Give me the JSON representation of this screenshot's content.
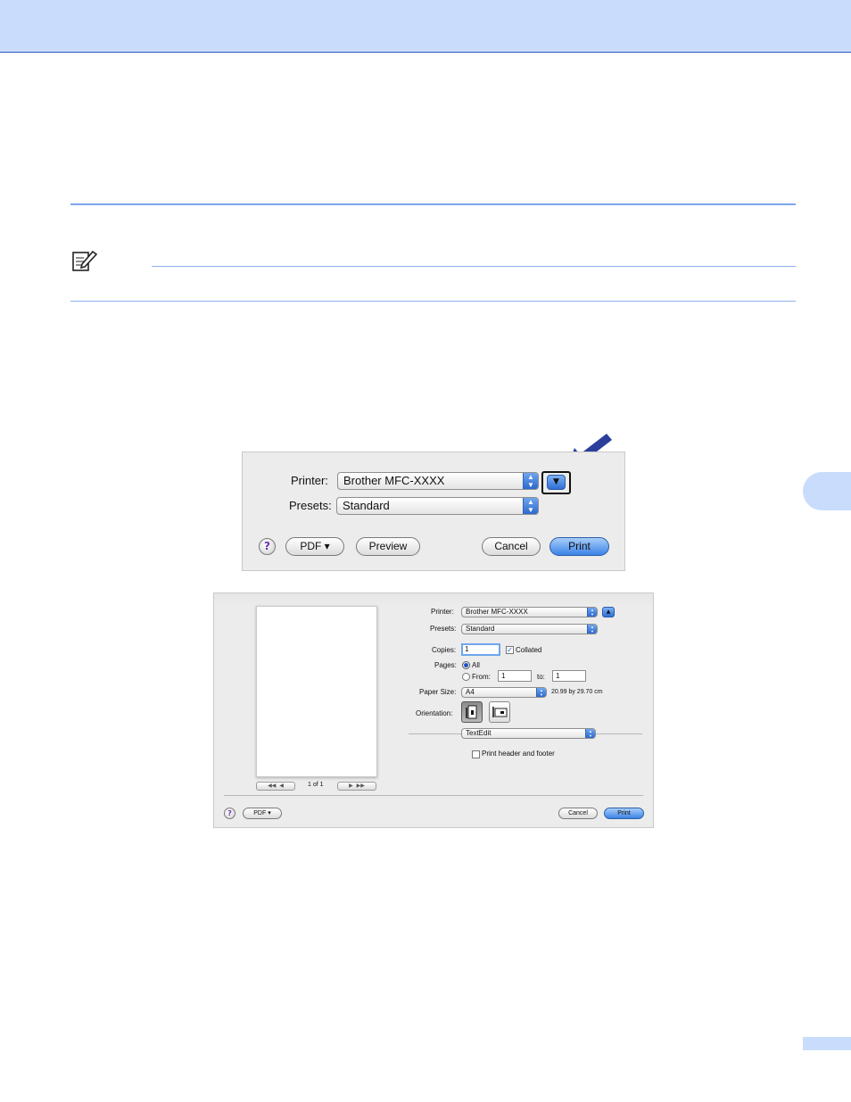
{
  "dialog_small": {
    "printer_label": "Printer:",
    "printer_value": "Brother MFC-XXXX",
    "presets_label": "Presets:",
    "presets_value": "Standard",
    "help_glyph": "?",
    "pdf_label": "PDF ▾",
    "preview_label": "Preview",
    "cancel_label": "Cancel",
    "print_label": "Print",
    "expand_glyph": "▼"
  },
  "dialog_large": {
    "printer_label": "Printer:",
    "printer_value": "Brother MFC-XXXX",
    "presets_label": "Presets:",
    "presets_value": "Standard",
    "collapse_glyph": "▲",
    "copies_label": "Copies:",
    "copies_value": "1",
    "collated_label": "Collated",
    "pages_label": "Pages:",
    "all_label": "All",
    "from_label": "From:",
    "from_value": "1",
    "to_label": "to:",
    "to_value": "1",
    "paper_size_label": "Paper Size:",
    "paper_size_value": "A4",
    "paper_dimensions": "20.99 by 29.70 cm",
    "orientation_label": "Orientation:",
    "section_value": "TextEdit",
    "header_footer_label": "Print header and footer",
    "page_counter": "1 of 1",
    "help_glyph": "?",
    "pdf_label": "PDF ▾",
    "cancel_label": "Cancel",
    "print_label": "Print"
  },
  "colors": {
    "band": "#c9dcfb",
    "rule": "#7ea4ee",
    "arrow": "#2b3f9a"
  },
  "icons": [
    "note-icon",
    "arrow-pointer-icon",
    "stepper-icon",
    "portrait-icon",
    "landscape-icon"
  ]
}
